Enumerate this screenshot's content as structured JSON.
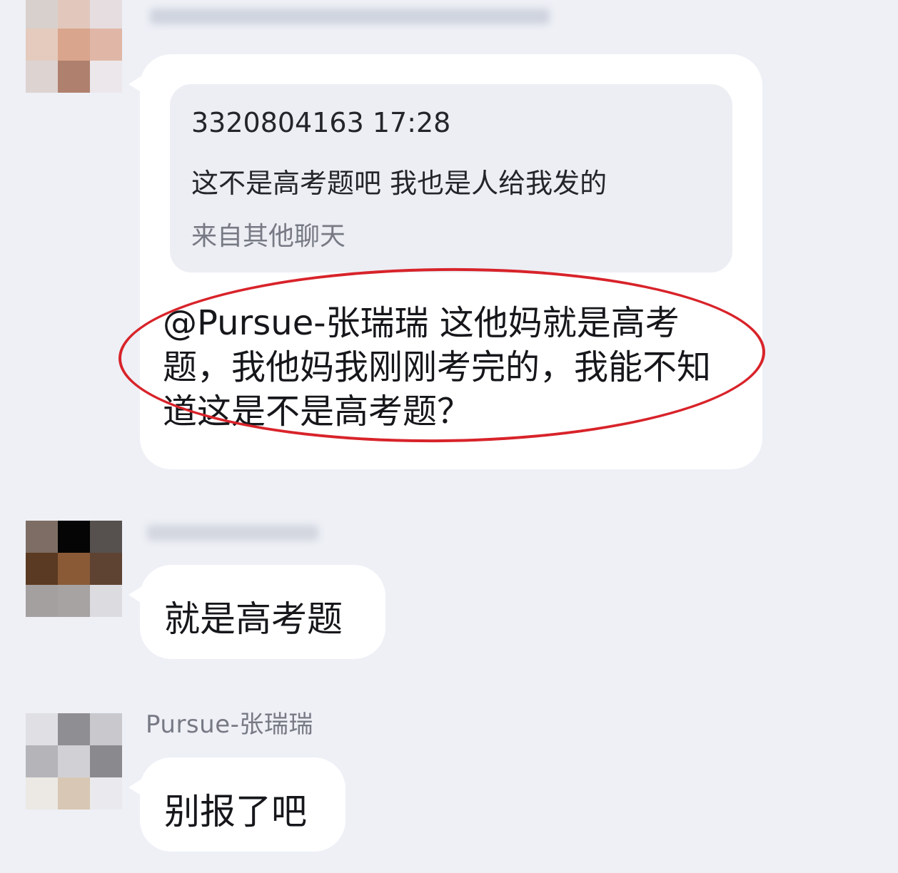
{
  "colors": {
    "background": "#eef0f6",
    "bubble": "#ffffff",
    "quote_box": "#eceef3",
    "annotation_circle": "#d8232a",
    "secondary_text": "#777a84"
  },
  "messages": [
    {
      "quote": {
        "meta": "3320804163 17:28",
        "text": "这不是高考题吧 我也是人给我发的",
        "source": "来自其他聊天"
      },
      "text": "@Pursue-张瑞瑞 这他妈就是高考题，我他妈我刚刚考完的，我能不知道这是不是高考题？"
    },
    {
      "text": "就是高考题"
    },
    {
      "sender": "Pursue-张瑞瑞",
      "text": "别报了吧"
    }
  ]
}
